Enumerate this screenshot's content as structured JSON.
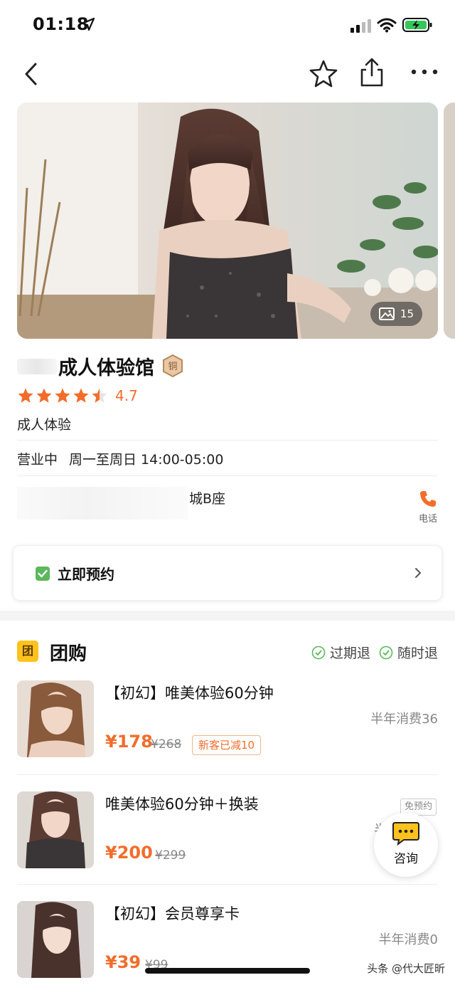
{
  "status_bar": {
    "time": "01:18"
  },
  "nav": {
    "back": "back",
    "favorite": "favorite",
    "share": "share",
    "more": "more"
  },
  "hero": {
    "photo_count": "15"
  },
  "shop": {
    "name": "成人体验馆",
    "badge": "铜",
    "rating": "4.7",
    "rating_stars": 4.5,
    "category": "成人体验",
    "business_status": "营业中",
    "hours": "周一至周日 14:00-05:00",
    "address": "城B座",
    "phone_label": "电话"
  },
  "booking": {
    "label": "立即预约"
  },
  "group_buy": {
    "badge": "团",
    "title": "团购",
    "tags": [
      "过期退",
      "随时退"
    ],
    "deals": [
      {
        "title": "【初幻】唯美体验60分钟",
        "sales": "半年消费36",
        "price": "¥178",
        "original_price": "¥268",
        "promo": "新客已减10",
        "tag": ""
      },
      {
        "title": "唯美体验60分钟＋换装",
        "sales": "半",
        "price": "¥200",
        "original_price": "¥299",
        "promo": "",
        "tag": "免预约"
      },
      {
        "title": "【初幻】会员尊享卡",
        "sales": "半年消费0",
        "price": "¥39",
        "original_price": "¥99",
        "promo": "",
        "tag": ""
      }
    ]
  },
  "consult": {
    "label": "咨询"
  },
  "watermark": "头条 @代大匠昕",
  "colors": {
    "accent": "#f26d2b",
    "badge_yellow": "#ffc21c",
    "check_green": "#4caf50"
  }
}
